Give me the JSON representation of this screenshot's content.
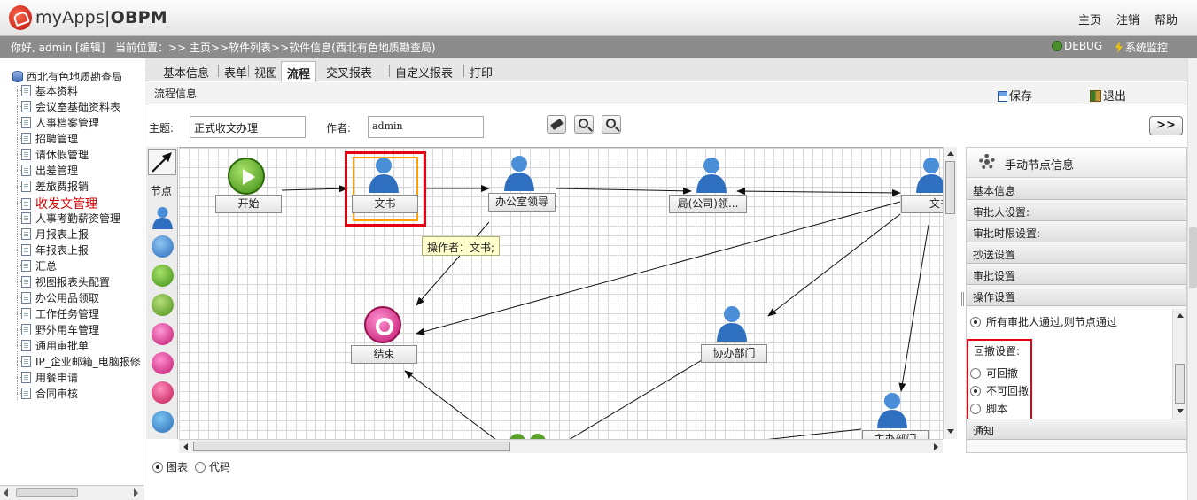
{
  "app": {
    "brand": "myApps",
    "product": "OBPM"
  },
  "topnav": {
    "home": "主页",
    "logout": "注销",
    "help": "帮助"
  },
  "infobar": {
    "greeting": "你好, admin [编辑]",
    "location": "当前位置：>> 主页>>软件列表>>软件信息(西北有色地质勘查局)",
    "debug": "DEBUG",
    "monitor": "系统监控"
  },
  "tree": {
    "root": "西北有色地质勘查局",
    "items": [
      "基本资料",
      "会议室基础资料表",
      "人事档案管理",
      "招聘管理",
      "请休假管理",
      "出差管理",
      "差旅费报销",
      "收发文管理",
      "人事考勤薪资管理",
      "月报表上报",
      "年报表上报",
      "汇总",
      "视图报表头配置",
      "办公用品领取",
      "工作任务管理",
      "野外用车管理",
      "通用审批单",
      "IP_企业邮箱_电脑报修",
      "用餐申请",
      "合同审核"
    ],
    "active_index": 7
  },
  "tabs": [
    "基本信息",
    "表单",
    "视图",
    "流程",
    "交叉报表",
    "自定义报表",
    "打印"
  ],
  "active_tab": 3,
  "subheader": {
    "title": "流程信息",
    "save": "保存",
    "exit": "退出"
  },
  "form": {
    "subject_label": "主题:",
    "subject_value": "正式收文办理",
    "author_label": "作者:",
    "author_value": "admin",
    "expand": ">>"
  },
  "palette": {
    "label": "节点"
  },
  "nodes": {
    "start": "开始",
    "clerk": "文书",
    "office_leader": "办公室领导",
    "bureau_leader": "局(公司)领...",
    "clerk2": "文书",
    "end": "结束",
    "assist_dept": "协办部门",
    "main_dept": "主办部门"
  },
  "tooltip": "操作者：文书;",
  "right_panel": {
    "title": "手动节点信息",
    "sections": [
      "基本信息",
      "审批人设置:",
      "审批时限设置:",
      "抄送设置",
      "审批设置",
      "操作设置"
    ],
    "pass_rule": "所有审批人通过,则节点通过",
    "revoke_label": "回撤设置:",
    "revoke_options": [
      "可回撤",
      "不可回撤",
      "脚本"
    ],
    "revoke_selected": 1,
    "notify": "通知"
  },
  "bottom": {
    "options": [
      "图表",
      "代码"
    ],
    "selected": 0
  },
  "colors": {
    "highlight_red": "#e60012",
    "selection_orange": "#ff9f00",
    "active_tree_item": "#d40000"
  }
}
